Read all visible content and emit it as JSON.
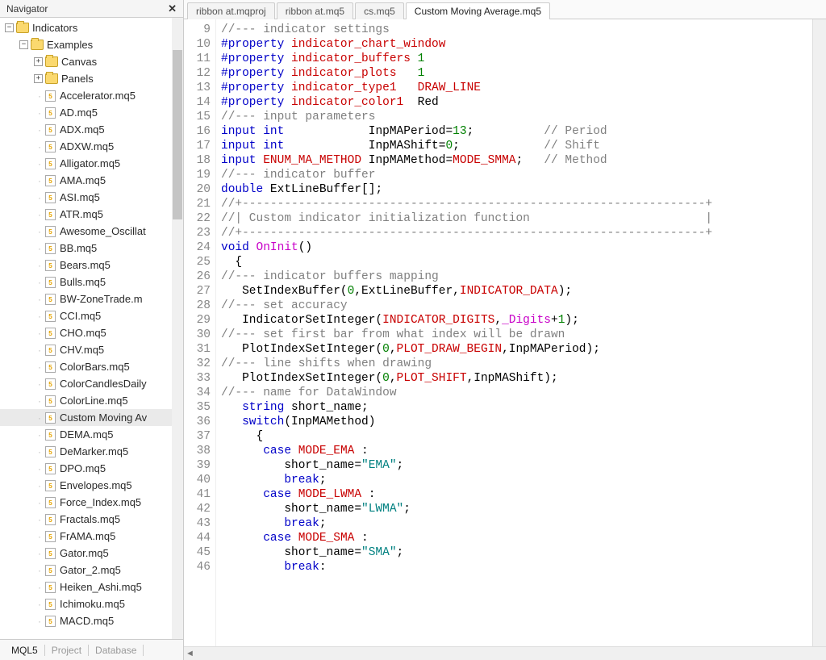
{
  "navigator": {
    "title": "Navigator",
    "root": "Indicators",
    "folders": [
      "Examples",
      "Canvas",
      "Panels"
    ],
    "files": [
      "Accelerator.mq5",
      "AD.mq5",
      "ADX.mq5",
      "ADXW.mq5",
      "Alligator.mq5",
      "AMA.mq5",
      "ASI.mq5",
      "ATR.mq5",
      "Awesome_Oscillat",
      "BB.mq5",
      "Bears.mq5",
      "Bulls.mq5",
      "BW-ZoneTrade.m",
      "CCI.mq5",
      "CHO.mq5",
      "CHV.mq5",
      "ColorBars.mq5",
      "ColorCandlesDaily",
      "ColorLine.mq5",
      "Custom Moving Av",
      "DEMA.mq5",
      "DeMarker.mq5",
      "DPO.mq5",
      "Envelopes.mq5",
      "Force_Index.mq5",
      "Fractals.mq5",
      "FrAMA.mq5",
      "Gator.mq5",
      "Gator_2.mq5",
      "Heiken_Ashi.mq5",
      "Ichimoku.mq5",
      "MACD.mq5"
    ],
    "selected_file_index": 19,
    "bottom_tabs": [
      "MQL5",
      "Project",
      "Database"
    ],
    "bottom_active": 0
  },
  "editor": {
    "tabs": [
      "ribbon at.mqproj",
      "ribbon at.mq5",
      "cs.mq5",
      "Custom Moving Average.mq5"
    ],
    "active_tab": 3,
    "first_line": 9,
    "lines": [
      {
        "t": [
          [
            "//--- indicator settings",
            "cmt"
          ]
        ]
      },
      {
        "t": [
          [
            "#property ",
            "pp"
          ],
          [
            "indicator_chart_window",
            "red"
          ]
        ]
      },
      {
        "t": [
          [
            "#property ",
            "pp"
          ],
          [
            "indicator_buffers ",
            "red"
          ],
          [
            "1",
            "grn"
          ]
        ]
      },
      {
        "t": [
          [
            "#property ",
            "pp"
          ],
          [
            "indicator_plots   ",
            "red"
          ],
          [
            "1",
            "grn"
          ]
        ]
      },
      {
        "t": [
          [
            "#property ",
            "pp"
          ],
          [
            "indicator_type1   ",
            "red"
          ],
          [
            "DRAW_LINE",
            "red"
          ]
        ]
      },
      {
        "t": [
          [
            "#property ",
            "pp"
          ],
          [
            "indicator_color1  ",
            "red"
          ],
          [
            "Red",
            ""
          ]
        ]
      },
      {
        "t": [
          [
            "//--- input parameters",
            "cmt"
          ]
        ]
      },
      {
        "t": [
          [
            "input ",
            "kw"
          ],
          [
            "int",
            "kw"
          ],
          [
            "            InpMAPeriod=",
            ""
          ],
          [
            "13",
            "num"
          ],
          [
            ";          ",
            ""
          ],
          [
            "// Period",
            "cmt"
          ]
        ]
      },
      {
        "t": [
          [
            "input ",
            "kw"
          ],
          [
            "int",
            "kw"
          ],
          [
            "            InpMAShift=",
            ""
          ],
          [
            "0",
            "num"
          ],
          [
            ";            ",
            ""
          ],
          [
            "// Shift",
            "cmt"
          ]
        ]
      },
      {
        "t": [
          [
            "input ",
            "kw"
          ],
          [
            "ENUM_MA_METHOD ",
            "red"
          ],
          [
            "InpMAMethod=",
            ""
          ],
          [
            "MODE_SMMA",
            "red"
          ],
          [
            ";   ",
            ""
          ],
          [
            "// Method",
            "cmt"
          ]
        ]
      },
      {
        "t": [
          [
            "//--- indicator buffer",
            "cmt"
          ]
        ]
      },
      {
        "t": [
          [
            "double ",
            "kw"
          ],
          [
            "ExtLineBuffer[];",
            ""
          ]
        ]
      },
      {
        "t": [
          [
            "//+------------------------------------------------------------------+",
            "cmt"
          ]
        ]
      },
      {
        "t": [
          [
            "//| Custom indicator initialization function                         |",
            "cmt"
          ]
        ]
      },
      {
        "t": [
          [
            "//+------------------------------------------------------------------+",
            "cmt"
          ]
        ]
      },
      {
        "t": [
          [
            "void ",
            "kw"
          ],
          [
            "OnInit",
            "mag"
          ],
          [
            "()",
            ""
          ]
        ]
      },
      {
        "t": [
          [
            "  {",
            ""
          ]
        ]
      },
      {
        "t": [
          [
            "//--- indicator buffers mapping",
            "cmt"
          ]
        ]
      },
      {
        "t": [
          [
            "   SetIndexBuffer(",
            ""
          ],
          [
            "0",
            "num"
          ],
          [
            ",ExtLineBuffer,",
            ""
          ],
          [
            "INDICATOR_DATA",
            "red"
          ],
          [
            ");",
            ""
          ]
        ]
      },
      {
        "t": [
          [
            "//--- set accuracy",
            "cmt"
          ]
        ]
      },
      {
        "t": [
          [
            "   IndicatorSetInteger(",
            ""
          ],
          [
            "INDICATOR_DIGITS",
            "red"
          ],
          [
            ",",
            ""
          ],
          [
            "_Digits",
            "mag"
          ],
          [
            "+",
            ""
          ],
          [
            "1",
            "num"
          ],
          [
            ");",
            ""
          ]
        ]
      },
      {
        "t": [
          [
            "//--- set first bar from what index will be drawn",
            "cmt"
          ]
        ]
      },
      {
        "t": [
          [
            "   PlotIndexSetInteger(",
            ""
          ],
          [
            "0",
            "num"
          ],
          [
            ",",
            ""
          ],
          [
            "PLOT_DRAW_BEGIN",
            "red"
          ],
          [
            ",InpMAPeriod);",
            ""
          ]
        ]
      },
      {
        "t": [
          [
            "//--- line shifts when drawing",
            "cmt"
          ]
        ]
      },
      {
        "t": [
          [
            "   PlotIndexSetInteger(",
            ""
          ],
          [
            "0",
            "num"
          ],
          [
            ",",
            ""
          ],
          [
            "PLOT_SHIFT",
            "red"
          ],
          [
            ",InpMAShift);",
            ""
          ]
        ]
      },
      {
        "t": [
          [
            "//--- name for DataWindow",
            "cmt"
          ]
        ]
      },
      {
        "t": [
          [
            "   ",
            ""
          ],
          [
            "string ",
            "kw"
          ],
          [
            "short_name;",
            ""
          ]
        ]
      },
      {
        "t": [
          [
            "   ",
            ""
          ],
          [
            "switch",
            "kw"
          ],
          [
            "(InpMAMethod)",
            ""
          ]
        ]
      },
      {
        "t": [
          [
            "     {",
            ""
          ]
        ]
      },
      {
        "t": [
          [
            "      ",
            ""
          ],
          [
            "case ",
            "kw"
          ],
          [
            "MODE_EMA",
            "red"
          ],
          [
            " :",
            ""
          ]
        ]
      },
      {
        "t": [
          [
            "         short_name=",
            ""
          ],
          [
            "\"EMA\"",
            "str"
          ],
          [
            ";",
            ""
          ]
        ]
      },
      {
        "t": [
          [
            "         ",
            ""
          ],
          [
            "break",
            "kw"
          ],
          [
            ";",
            ""
          ]
        ]
      },
      {
        "t": [
          [
            "      ",
            ""
          ],
          [
            "case ",
            "kw"
          ],
          [
            "MODE_LWMA",
            "red"
          ],
          [
            " :",
            ""
          ]
        ]
      },
      {
        "t": [
          [
            "         short_name=",
            ""
          ],
          [
            "\"LWMA\"",
            "str"
          ],
          [
            ";",
            ""
          ]
        ]
      },
      {
        "t": [
          [
            "         ",
            ""
          ],
          [
            "break",
            "kw"
          ],
          [
            ";",
            ""
          ]
        ]
      },
      {
        "t": [
          [
            "      ",
            ""
          ],
          [
            "case ",
            "kw"
          ],
          [
            "MODE_SMA",
            "red"
          ],
          [
            " :",
            ""
          ]
        ]
      },
      {
        "t": [
          [
            "         short_name=",
            ""
          ],
          [
            "\"SMA\"",
            "str"
          ],
          [
            ";",
            ""
          ]
        ]
      },
      {
        "t": [
          [
            "         ",
            ""
          ],
          [
            "break",
            "kw"
          ],
          [
            ":",
            ""
          ]
        ]
      }
    ]
  }
}
